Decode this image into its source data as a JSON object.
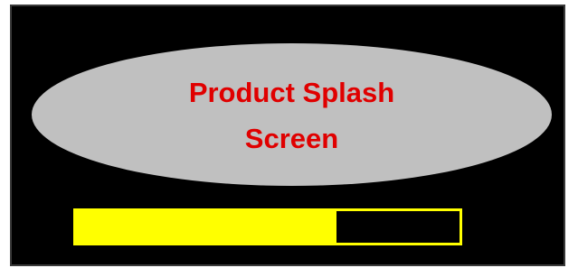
{
  "splash": {
    "title": "Product Splash Screen"
  },
  "progress": {
    "fraction": 0.68
  },
  "colors": {
    "background": "#000000",
    "ellipse": "#c0c0c0",
    "title": "#e00000",
    "progress_bar": "#ffff00",
    "progress_track": "#000000"
  }
}
